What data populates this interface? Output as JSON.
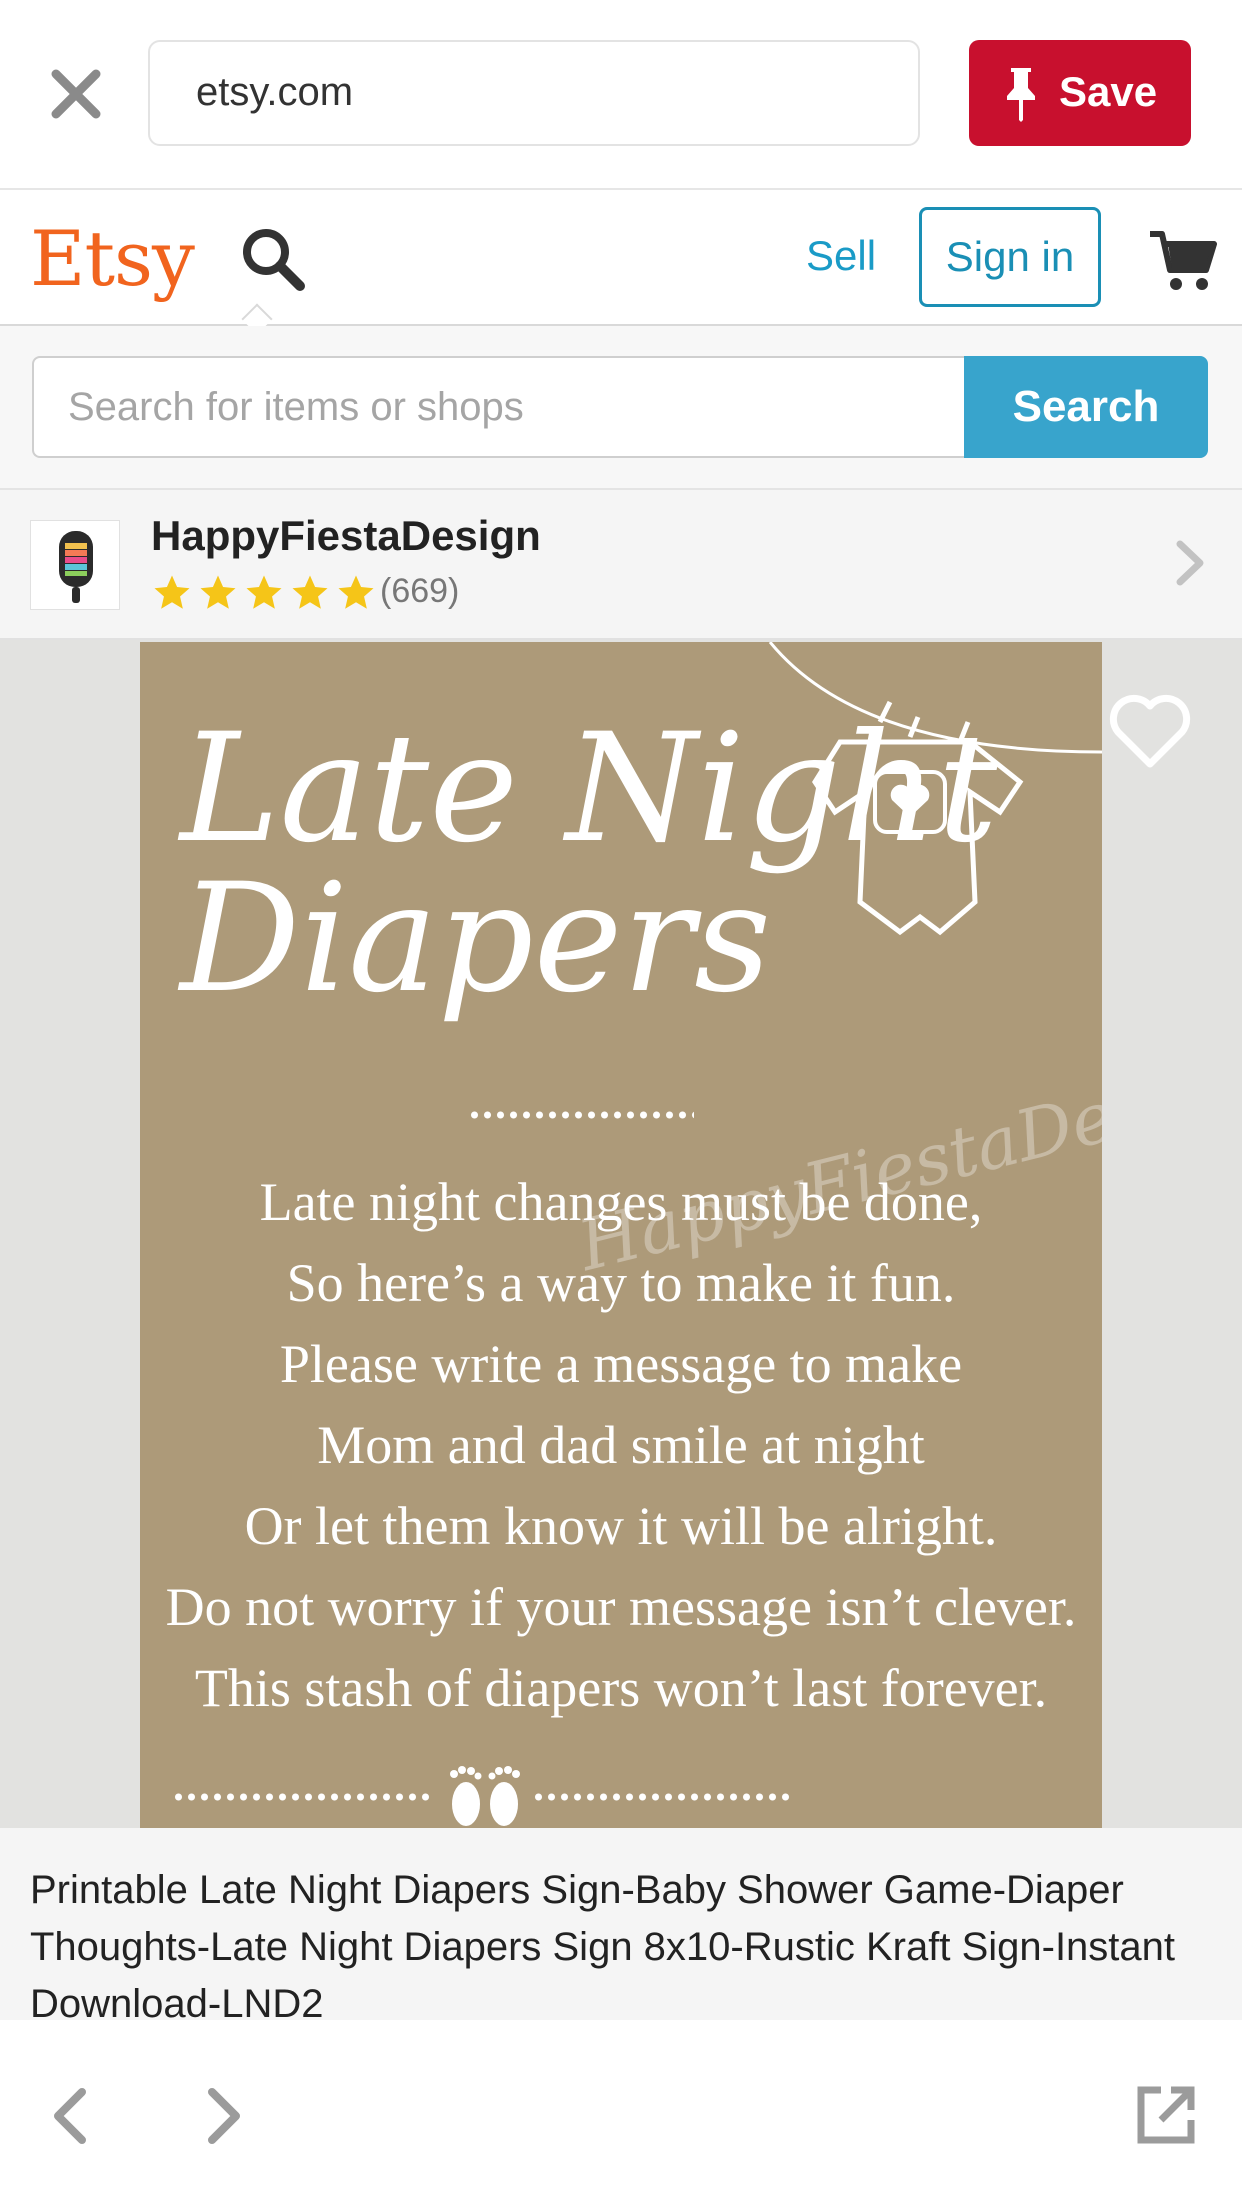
{
  "browser": {
    "url": "etsy.com",
    "save_label": "Save",
    "save_color": "#c8102e"
  },
  "header": {
    "logo": "Etsy",
    "logo_color": "#f1641e",
    "sell_label": "Sell",
    "signin_label": "Sign in",
    "accent_color": "#1a9bc7"
  },
  "search": {
    "placeholder": "Search for items or shops",
    "value": "",
    "button_label": "Search",
    "button_color": "#38a4cc"
  },
  "shop": {
    "name": "HappyFiestaDesign",
    "rating": 5,
    "max_rating": 5,
    "reviews": "(669)"
  },
  "listing_image": {
    "title_line1": "Late Night",
    "title_line2": "Diapers",
    "watermark": "HappyFiestaDesign",
    "poem": [
      "Late night changes must be done,",
      "So here’s a way to make it fun.",
      "Please write a message to make",
      "Mom and dad smile at night",
      "Or let them know it will be alright.",
      "Do not worry if your message isn’t clever.",
      "This stash of diapers won’t last forever."
    ],
    "background_color": "#ad9a79"
  },
  "listing": {
    "title": "Printable Late Night Diapers Sign-Baby Shower Game-Diaper Thoughts-Late Night Diapers Sign 8x10-Rustic Kraft Sign-Instant Download-LND2"
  },
  "icons": {
    "close": "close-icon",
    "pin": "pin-icon",
    "search": "magnifier-icon",
    "cart": "cart-icon",
    "heart": "heart-icon",
    "back": "chevron-left-icon",
    "forward": "chevron-right-icon",
    "share": "external-link-icon"
  }
}
